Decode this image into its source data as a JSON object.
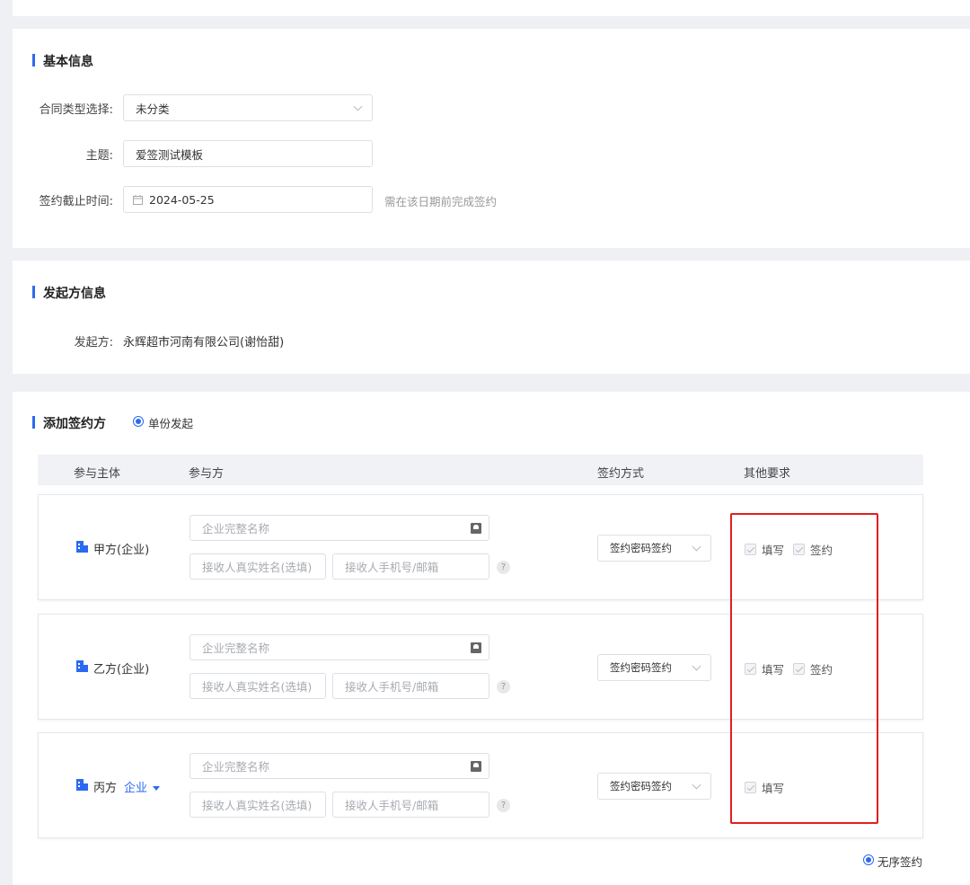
{
  "basic": {
    "title": "基本信息",
    "type_label": "合同类型选择:",
    "type_value": "未分类",
    "subject_label": "主题:",
    "subject_value": "爱签测试模板",
    "deadline_label": "签约截止时间:",
    "deadline_value": "2024-05-25",
    "deadline_hint": "需在该日期前完成签约"
  },
  "initiator": {
    "title": "发起方信息",
    "label": "发起方:",
    "value": "永辉超市河南有限公司(谢怡甜)"
  },
  "signers": {
    "title": "添加签约方",
    "mode_option": "单份发起",
    "headers": [
      "参与主体",
      "参与方",
      "签约方式",
      "其他要求"
    ],
    "company_placeholder": "企业完整名称",
    "name_placeholder": "接收人真实姓名(选填)",
    "phone_placeholder": "接收人手机号/邮箱",
    "help_glyph": "?",
    "rows": [
      {
        "party": "甲方(企业)",
        "method": "签约密码签约",
        "req_fill": "填写",
        "req_sign": "签约"
      },
      {
        "party": "乙方(企业)",
        "method": "签约密码签约",
        "req_fill": "填写",
        "req_sign": "签约"
      },
      {
        "party": "丙方",
        "type": "企业",
        "method": "签约密码签约",
        "req_fill": "填写"
      }
    ],
    "order_option": "无序签约"
  },
  "colors": {
    "accent": "#2b6af0",
    "highlight": "#e02020"
  }
}
